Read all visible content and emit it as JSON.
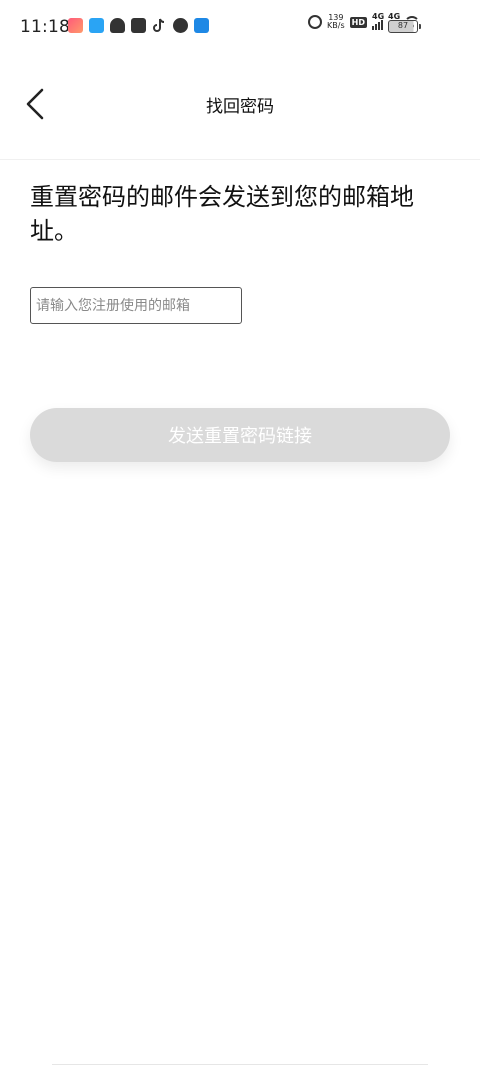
{
  "status_bar": {
    "time": "11:18",
    "net_speed_value": "139",
    "net_speed_unit": "KB/s",
    "hd_label": "HD",
    "sim1_label": "4G",
    "sim2_label": "4G",
    "battery_level": "87"
  },
  "header": {
    "title": "找回密码"
  },
  "content": {
    "instruction": "重置密码的邮件会发送到您的邮箱地址。",
    "email_placeholder": "请输入您注册使用的邮箱",
    "email_value": ""
  },
  "actions": {
    "send_label": "发送重置密码链接"
  },
  "colors": {
    "button_disabled_bg": "#dadada",
    "button_text": "#ffffff",
    "input_border": "#555555"
  }
}
